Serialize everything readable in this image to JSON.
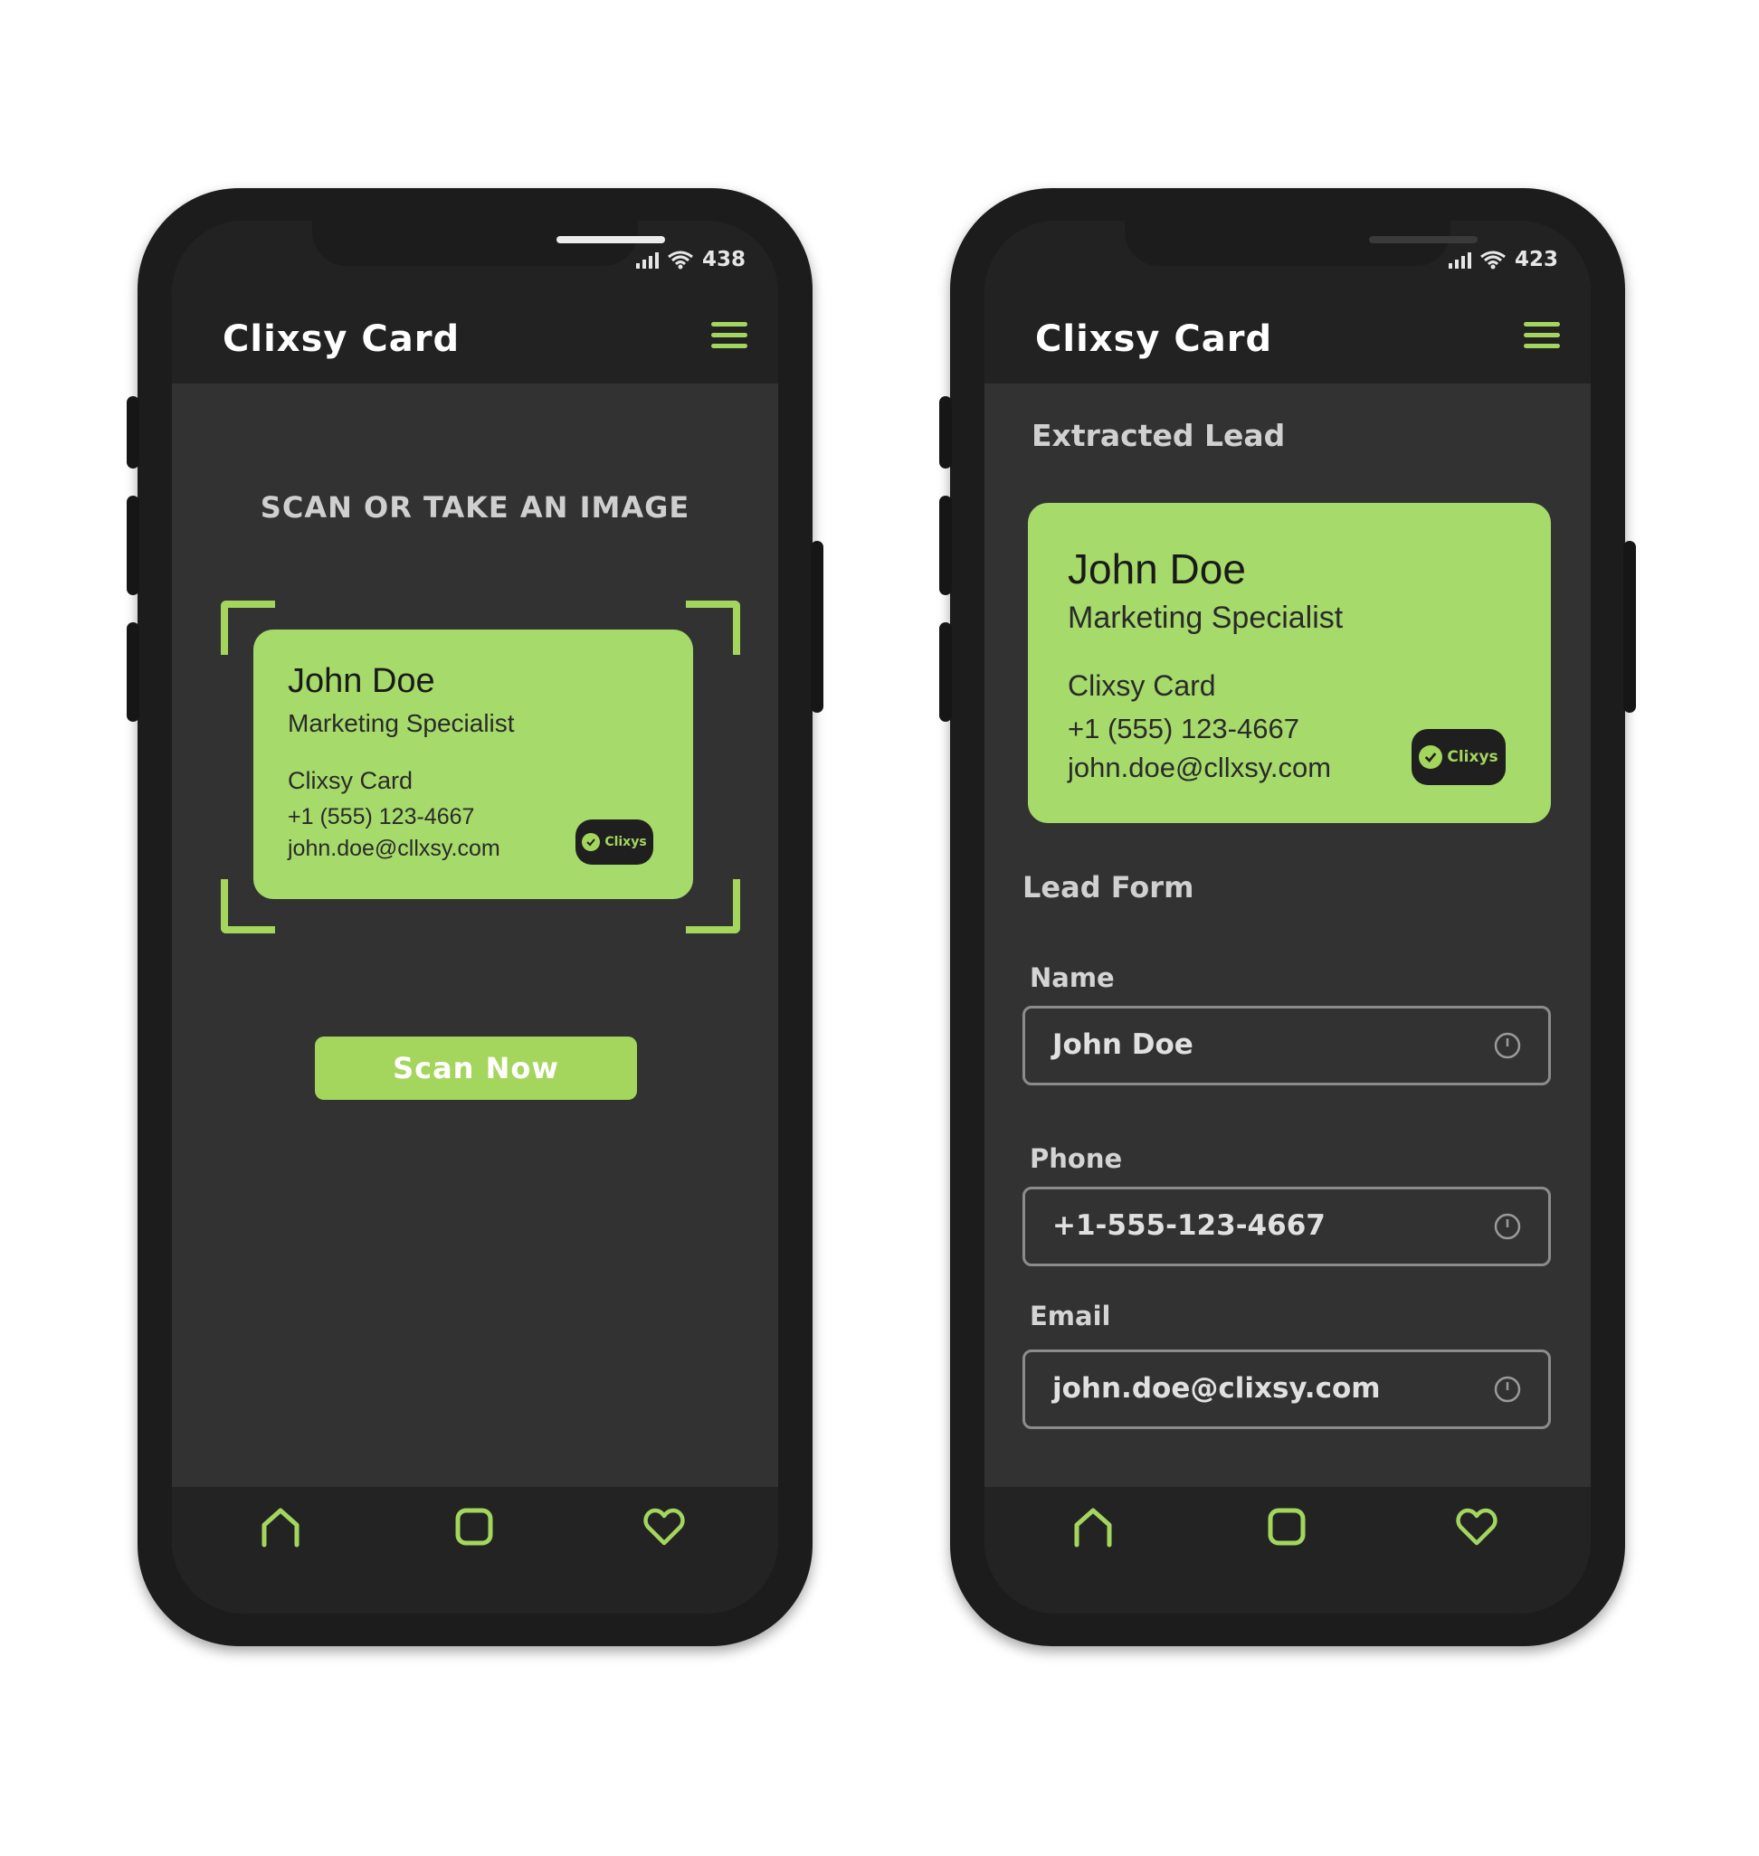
{
  "colors": {
    "accent": "#a4d65e",
    "screen_bg": "#323232",
    "header_bg": "#222222",
    "card_bg": "#a6da6a",
    "frame": "#1c1c1c"
  },
  "left_phone": {
    "status": {
      "battery": "438",
      "icons": [
        "signal-icon",
        "wifi-icon"
      ]
    },
    "header": {
      "logo": "Clixsy Card",
      "menu_icon": "hamburger-menu-icon"
    },
    "scan_title": "SCAN OR TAKE AN IMAGE",
    "card": {
      "name": "John Doe",
      "title": "Marketing Specialist",
      "company": "Clixsy Card",
      "phone": "+1 (555) 123-4667",
      "email": "john.doe@cllxsy.com",
      "badge": "Clixys"
    },
    "scan_button": "Scan Now",
    "nav": [
      "home-icon",
      "square-icon",
      "heart-icon"
    ]
  },
  "right_phone": {
    "status": {
      "battery": "423",
      "icons": [
        "signal-icon",
        "wifi-icon"
      ]
    },
    "header": {
      "logo": "Clixsy Card",
      "menu_icon": "hamburger-menu-icon"
    },
    "extracted_title": "Extracted Lead",
    "card": {
      "name": "John Doe",
      "title": "Marketing Specialist",
      "company": "Clixsy Card",
      "phone": "+1 (555) 123-4667",
      "email": "john.doe@cllxsy.com",
      "badge": "Clixys"
    },
    "form_title": "Lead Form",
    "form": {
      "name_label": "Name",
      "name_value": "John Doe",
      "phone_label": "Phone",
      "phone_value": "+1-555-123-4667",
      "email_label": "Email",
      "email_value": "john.doe@clixsy.com"
    },
    "nav": [
      "home-icon",
      "square-icon",
      "heart-icon"
    ]
  }
}
